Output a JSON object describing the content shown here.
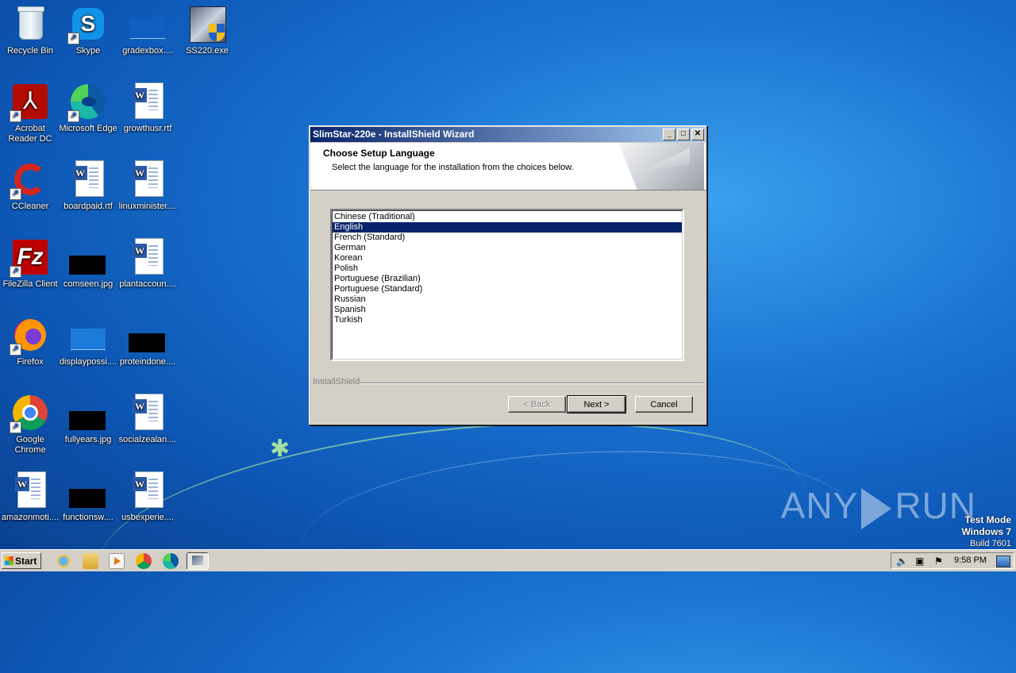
{
  "desktop": {
    "icons": [
      {
        "label": "Recycle Bin",
        "icon": "recycle-bin-icon"
      },
      {
        "label": "Skype",
        "icon": "skype-icon"
      },
      {
        "label": "gradexbox....",
        "icon": "file-icon"
      },
      {
        "label": "SS220.exe",
        "icon": "installer-icon"
      },
      {
        "label": "Acrobat Reader DC",
        "icon": "acrobat-icon"
      },
      {
        "label": "Microsoft Edge",
        "icon": "edge-icon"
      },
      {
        "label": "growthusr.rtf",
        "icon": "word-doc-icon"
      },
      {
        "label": "CCleaner",
        "icon": "ccleaner-icon"
      },
      {
        "label": "boardpaid.rtf",
        "icon": "word-doc-icon"
      },
      {
        "label": "linuxminister....",
        "icon": "word-doc-icon"
      },
      {
        "label": "FileZilla Client",
        "icon": "filezilla-icon"
      },
      {
        "label": "comseen.jpg",
        "icon": "image-icon"
      },
      {
        "label": "plantaccoun....",
        "icon": "word-doc-icon"
      },
      {
        "label": "Firefox",
        "icon": "firefox-icon"
      },
      {
        "label": "displaypossi....",
        "icon": "image-icon"
      },
      {
        "label": "proteindone....",
        "icon": "image-icon"
      },
      {
        "label": "Google Chrome",
        "icon": "chrome-icon"
      },
      {
        "label": "fullyears.jpg",
        "icon": "image-icon"
      },
      {
        "label": "socialzealan....",
        "icon": "word-doc-icon"
      },
      {
        "label": "amazonmoti....",
        "icon": "word-doc-icon"
      },
      {
        "label": "functionsw....",
        "icon": "image-icon"
      },
      {
        "label": "usbexperie....",
        "icon": "word-doc-icon"
      }
    ]
  },
  "dialog": {
    "title": "SlimStar-220e - InstallShield Wizard",
    "heading": "Choose Setup Language",
    "subheading": "Select the language for the installation from the choices below.",
    "languages": [
      "Chinese (Traditional)",
      "English",
      "French (Standard)",
      "German",
      "Korean",
      "Polish",
      "Portuguese (Brazilian)",
      "Portuguese (Standard)",
      "Russian",
      "Spanish",
      "Turkish"
    ],
    "selected_index": 1,
    "brand": "InstallShield",
    "back_label": "< Back",
    "next_label": "Next >",
    "cancel_label": "Cancel",
    "min_glyph": "_",
    "max_glyph": "□",
    "close_glyph": "✕"
  },
  "watermark": {
    "left": "ANY",
    "right": "RUN"
  },
  "os_info": {
    "mode": "Test Mode",
    "version": "Windows 7",
    "build": "Build 7601"
  },
  "taskbar": {
    "start_label": "Start",
    "clock": "9:58 PM"
  },
  "colors": {
    "title_start": "#0a246a",
    "title_end": "#a6caf0",
    "selection": "#0a246a"
  }
}
